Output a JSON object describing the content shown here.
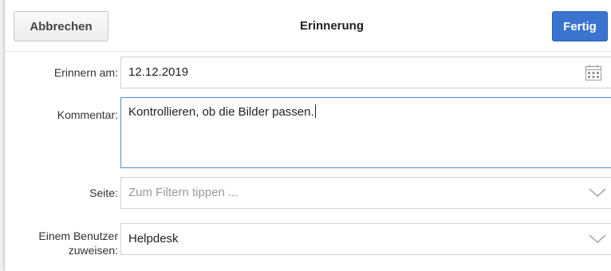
{
  "header": {
    "cancel_label": "Abbrechen",
    "title": "Erinnerung",
    "done_label": "Fertig"
  },
  "form": {
    "remind_on": {
      "label": "Erinnern am:",
      "value": "12.12.2019"
    },
    "comment": {
      "label": "Kommentar:",
      "value": "Kontrollieren, ob die Bilder passen."
    },
    "page": {
      "label": "Seite:",
      "placeholder": "Zum Filtern tippen ..."
    },
    "assign_user": {
      "label_line1": "Einem Benutzer",
      "label_line2": "zuweisen:",
      "value": "Helpdesk"
    }
  },
  "icons": {
    "date_picker": "calendar-icon",
    "dropdown": "chevron-down-icon"
  },
  "colors": {
    "accent": "#3a74cf",
    "focus_border": "#4f8fd8"
  }
}
